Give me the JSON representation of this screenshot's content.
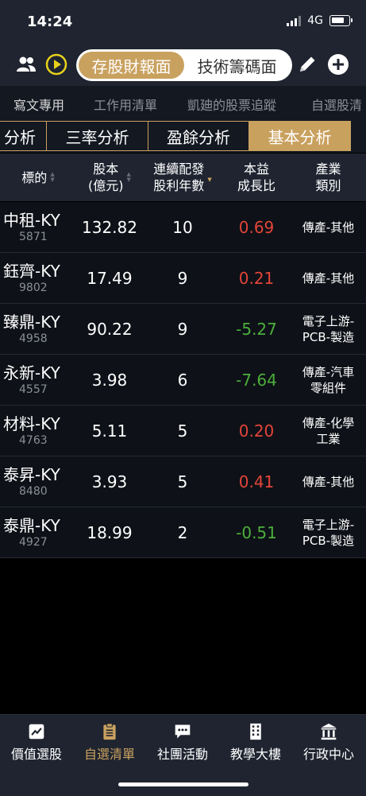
{
  "status": {
    "time": "14:24",
    "network": "4G",
    "battery_level": 0.9
  },
  "header": {
    "segments": [
      "存股財報面",
      "技術籌碼面"
    ],
    "active_segment": 0
  },
  "list_tabs": [
    "寫文專用",
    "工作用清單",
    "凱廸的股票追蹤",
    "自選股清"
  ],
  "analysis_tabs": [
    "分析",
    "三率分析",
    "盈餘分析",
    "基本分析"
  ],
  "table": {
    "columns": [
      {
        "line1": "標的",
        "line2": ""
      },
      {
        "line1": "股本",
        "line2": "(億元)"
      },
      {
        "line1": "連續配發",
        "line2": "股利年數"
      },
      {
        "line1": "本益",
        "line2": "成長比"
      },
      {
        "line1": "產業",
        "line2": "類別"
      }
    ],
    "rows": [
      {
        "name": "中租-KY",
        "code": "5871",
        "capital": "132.82",
        "years": "10",
        "peg": "0.69",
        "peg_color": "red",
        "industry1": "傳產-其他",
        "industry2": ""
      },
      {
        "name": "鈺齊-KY",
        "code": "9802",
        "capital": "17.49",
        "years": "9",
        "peg": "0.21",
        "peg_color": "red",
        "industry1": "傳產-其他",
        "industry2": ""
      },
      {
        "name": "臻鼎-KY",
        "code": "4958",
        "capital": "90.22",
        "years": "9",
        "peg": "-5.27",
        "peg_color": "green",
        "industry1": "電子上游-",
        "industry2": "PCB-製造"
      },
      {
        "name": "永新-KY",
        "code": "4557",
        "capital": "3.98",
        "years": "6",
        "peg": "-7.64",
        "peg_color": "green",
        "industry1": "傳產-汽車",
        "industry2": "零組件"
      },
      {
        "name": "材料-KY",
        "code": "4763",
        "capital": "5.11",
        "years": "5",
        "peg": "0.20",
        "peg_color": "red",
        "industry1": "傳產-化學",
        "industry2": "工業"
      },
      {
        "name": "泰昇-KY",
        "code": "8480",
        "capital": "3.93",
        "years": "5",
        "peg": "0.41",
        "peg_color": "red",
        "industry1": "傳產-其他",
        "industry2": ""
      },
      {
        "name": "泰鼎-KY",
        "code": "4927",
        "capital": "18.99",
        "years": "2",
        "peg": "-0.51",
        "peg_color": "green",
        "industry1": "電子上游-",
        "industry2": "PCB-製造"
      }
    ]
  },
  "bottom_nav": [
    {
      "label": "價值選股",
      "icon": "chart-icon"
    },
    {
      "label": "自選清單",
      "icon": "clipboard-icon",
      "active": true
    },
    {
      "label": "社團活動",
      "icon": "chat-icon"
    },
    {
      "label": "教學大樓",
      "icon": "building-icon"
    },
    {
      "label": "行政中心",
      "icon": "bank-icon"
    }
  ],
  "colors": {
    "accent": "#c9a15f",
    "up": "#e2453a",
    "down": "#4caf3c",
    "panel": "#1f2430",
    "background": "#000000"
  }
}
